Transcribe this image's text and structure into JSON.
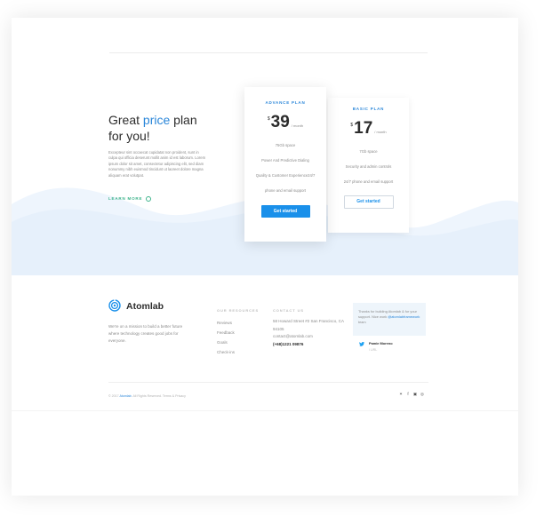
{
  "hero": {
    "title_prefix": "Great ",
    "title_accent": "price",
    "title_suffix": " plan",
    "title_line2": "for you!",
    "description": "Excepteur sint occaecat cupidatat non proident, sunt in culpa qui officia deserunt mollit anim id est laborum. Lorem ipsum dolor sit amet, consectetur adipiscing elit, sed diam nonummy nibh euismod tincidunt ut laoreet dolore magna aliquam erat volutpat.",
    "learn_more": "LEARN MORE"
  },
  "plans": [
    {
      "name": "ADVANCE PLAN",
      "currency": "$",
      "price": "39",
      "period": "/ month",
      "features": [
        "75Gb space",
        "Power And Predictive Dialing",
        "Quality & Customer Experience24/7",
        "phone and email support"
      ],
      "cta": "Get started"
    },
    {
      "name": "BASIC PLAN",
      "currency": "$",
      "price": "17",
      "period": "/ month",
      "features": [
        "7Gb space",
        "Security and admin controls",
        "24/7 phone and email support"
      ],
      "cta": "Get started"
    }
  ],
  "footer": {
    "brand": "Atomlab",
    "mission": "We're on a mission to build a better future where technology creates good jobs for everyone.",
    "resources_title": "OUR RESOURCES",
    "resources": [
      "Reviews",
      "Feedback",
      "Goals",
      "Check-ins"
    ],
    "contact_title": "CONTACT US",
    "address": "58 Howard Street #2 San Francisco, CA 94105",
    "email": "contact@atomlab.com",
    "phone": "(+68)1221 09876",
    "tweet_text": "Thanks for building Atomlab & for your support. Nice work",
    "tweet_link": "@atomlabframework",
    "tweet_suffix": " team",
    "tweet_name": "Pamie Moreno",
    "tweet_handle": "/ URL",
    "copyright_prefix": "© 2017 ",
    "copyright_brand": "Atomlab",
    "copyright_suffix": ". All Rights Reserved. Terms & Privacy",
    "social_icons": [
      "twitter-icon",
      "facebook-icon",
      "instagram-icon",
      "github-icon"
    ],
    "social_glyphs": [
      "✶",
      "f",
      "▣",
      "◎"
    ]
  },
  "colors": {
    "accent": "#2a86d9",
    "button": "#1a90ea",
    "learn_more": "#3bb38a",
    "wave": "#e9f2fc"
  }
}
